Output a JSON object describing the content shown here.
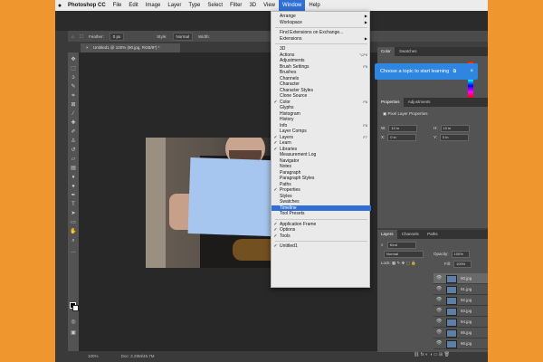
{
  "menubar": {
    "apple": "",
    "app": "Photoshop CC",
    "items": [
      "File",
      "Edit",
      "Image",
      "Layer",
      "Type",
      "Select",
      "Filter",
      "3D",
      "View",
      "Window",
      "Help"
    ],
    "active": "Window"
  },
  "options_bar": {
    "feather_label": "Feather:",
    "feather_value": "0 px",
    "style_label": "Style:",
    "style_value": "Normal",
    "width_label": "Width:"
  },
  "document_tab": {
    "close": "×",
    "title": "Untitled1 @ 100% (90.jpg, RGB/8*) *"
  },
  "window_menu": [
    {
      "label": "Arrange",
      "submenu": true
    },
    {
      "label": "Workspace",
      "submenu": true
    },
    {
      "sep": true
    },
    {
      "label": "Find Extensions on Exchange..."
    },
    {
      "label": "Extensions",
      "submenu": true
    },
    {
      "sep": true
    },
    {
      "label": "3D"
    },
    {
      "label": "Actions",
      "shortcut": "⌥F9"
    },
    {
      "label": "Adjustments"
    },
    {
      "label": "Brush Settings",
      "shortcut": "F5"
    },
    {
      "label": "Brushes"
    },
    {
      "label": "Channels"
    },
    {
      "label": "Character"
    },
    {
      "label": "Character Styles"
    },
    {
      "label": "Clone Source"
    },
    {
      "label": "Color",
      "checked": true,
      "shortcut": "F6"
    },
    {
      "label": "Glyphs"
    },
    {
      "label": "Histogram"
    },
    {
      "label": "History"
    },
    {
      "label": "Info",
      "shortcut": "F8"
    },
    {
      "label": "Layer Comps"
    },
    {
      "label": "Layers",
      "checked": true,
      "shortcut": "F7"
    },
    {
      "label": "Learn",
      "checked": true
    },
    {
      "label": "Libraries",
      "checked": true
    },
    {
      "label": "Measurement Log"
    },
    {
      "label": "Navigator"
    },
    {
      "label": "Notes"
    },
    {
      "label": "Paragraph"
    },
    {
      "label": "Paragraph Styles"
    },
    {
      "label": "Paths"
    },
    {
      "label": "Properties",
      "checked": true
    },
    {
      "label": "Styles"
    },
    {
      "label": "Swatches"
    },
    {
      "label": "Timeline",
      "highlighted": true
    },
    {
      "label": "Tool Presets"
    },
    {
      "sep": true
    },
    {
      "label": "Application Frame",
      "checked": true
    },
    {
      "label": "Options",
      "checked": true
    },
    {
      "label": "Tools",
      "checked": true
    },
    {
      "sep": true
    },
    {
      "label": "Untitled1",
      "checked": true
    }
  ],
  "panels": {
    "color_tabs": [
      "Color",
      "Swatches"
    ],
    "learn_tip": {
      "text": "Choose a topic to start learning",
      "close": "×"
    },
    "properties_tabs": [
      "Properties",
      "Adjustments"
    ],
    "properties_title": "Pixel Layer Properties",
    "props": {
      "w_label": "W:",
      "w_value": "10 in",
      "h_label": "H:",
      "h_value": "10 in",
      "x_label": "X:",
      "x_value": "0 in",
      "y_label": "Y:",
      "y_value": "0 in"
    },
    "layers_tabs": [
      "Layers",
      "Channels",
      "Paths"
    ],
    "kind_label": "Kind",
    "blend_mode": "Normal",
    "opacity_label": "Opacity:",
    "opacity_value": "100%",
    "lock_label": "Lock:",
    "fill_label": "Fill:",
    "fill_value": "100%",
    "layers": [
      "90.jpg",
      "91.jpg",
      "92.jpg",
      "93.jpg",
      "94.jpg",
      "95.jpg",
      "96.jpg"
    ]
  },
  "status": {
    "zoom": "100%",
    "doc": "Doc: 2.29M/45.7M"
  }
}
